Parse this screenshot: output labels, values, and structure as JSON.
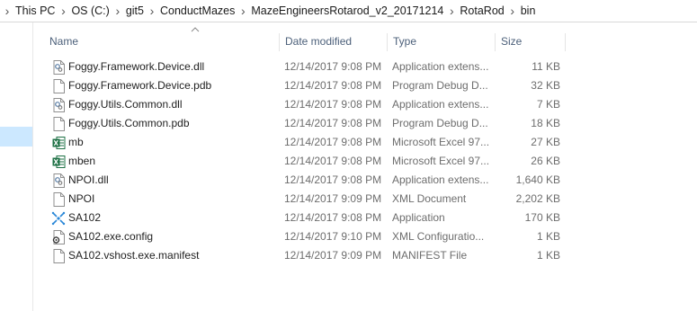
{
  "breadcrumb": [
    "This PC",
    "OS (C:)",
    "git5",
    "ConductMazes",
    "MazeEngineersRotarod_v2_20171214",
    "RotaRod",
    "bin"
  ],
  "columns": {
    "name": "Name",
    "date": "Date modified",
    "type": "Type",
    "size": "Size"
  },
  "files": [
    {
      "icon": "dll-file-icon",
      "name": "Foggy.Framework.Device.dll",
      "date": "12/14/2017 9:08 PM",
      "type": "Application extens...",
      "size": "11 KB"
    },
    {
      "icon": "generic-file-icon",
      "name": "Foggy.Framework.Device.pdb",
      "date": "12/14/2017 9:08 PM",
      "type": "Program Debug D...",
      "size": "32 KB"
    },
    {
      "icon": "dll-file-icon",
      "name": "Foggy.Utils.Common.dll",
      "date": "12/14/2017 9:08 PM",
      "type": "Application extens...",
      "size": "7 KB"
    },
    {
      "icon": "generic-file-icon",
      "name": "Foggy.Utils.Common.pdb",
      "date": "12/14/2017 9:08 PM",
      "type": "Program Debug D...",
      "size": "18 KB"
    },
    {
      "icon": "excel-file-icon",
      "name": "mb",
      "date": "12/14/2017 9:08 PM",
      "type": "Microsoft Excel 97...",
      "size": "27 KB"
    },
    {
      "icon": "excel-file-icon",
      "name": "mben",
      "date": "12/14/2017 9:08 PM",
      "type": "Microsoft Excel 97...",
      "size": "26 KB"
    },
    {
      "icon": "dll-file-icon",
      "name": "NPOI.dll",
      "date": "12/14/2017 9:08 PM",
      "type": "Application extens...",
      "size": "1,640 KB"
    },
    {
      "icon": "generic-file-icon",
      "name": "NPOI",
      "date": "12/14/2017 9:09 PM",
      "type": "XML Document",
      "size": "2,202 KB"
    },
    {
      "icon": "application-icon",
      "name": "SA102",
      "date": "12/14/2017 9:08 PM",
      "type": "Application",
      "size": "170 KB"
    },
    {
      "icon": "config-file-icon",
      "name": "SA102.exe.config",
      "date": "12/14/2017 9:10 PM",
      "type": "XML Configuratio...",
      "size": "1 KB"
    },
    {
      "icon": "generic-file-icon",
      "name": "SA102.vshost.exe.manifest",
      "date": "12/14/2017 9:09 PM",
      "type": "MANIFEST File",
      "size": "1 KB"
    }
  ]
}
